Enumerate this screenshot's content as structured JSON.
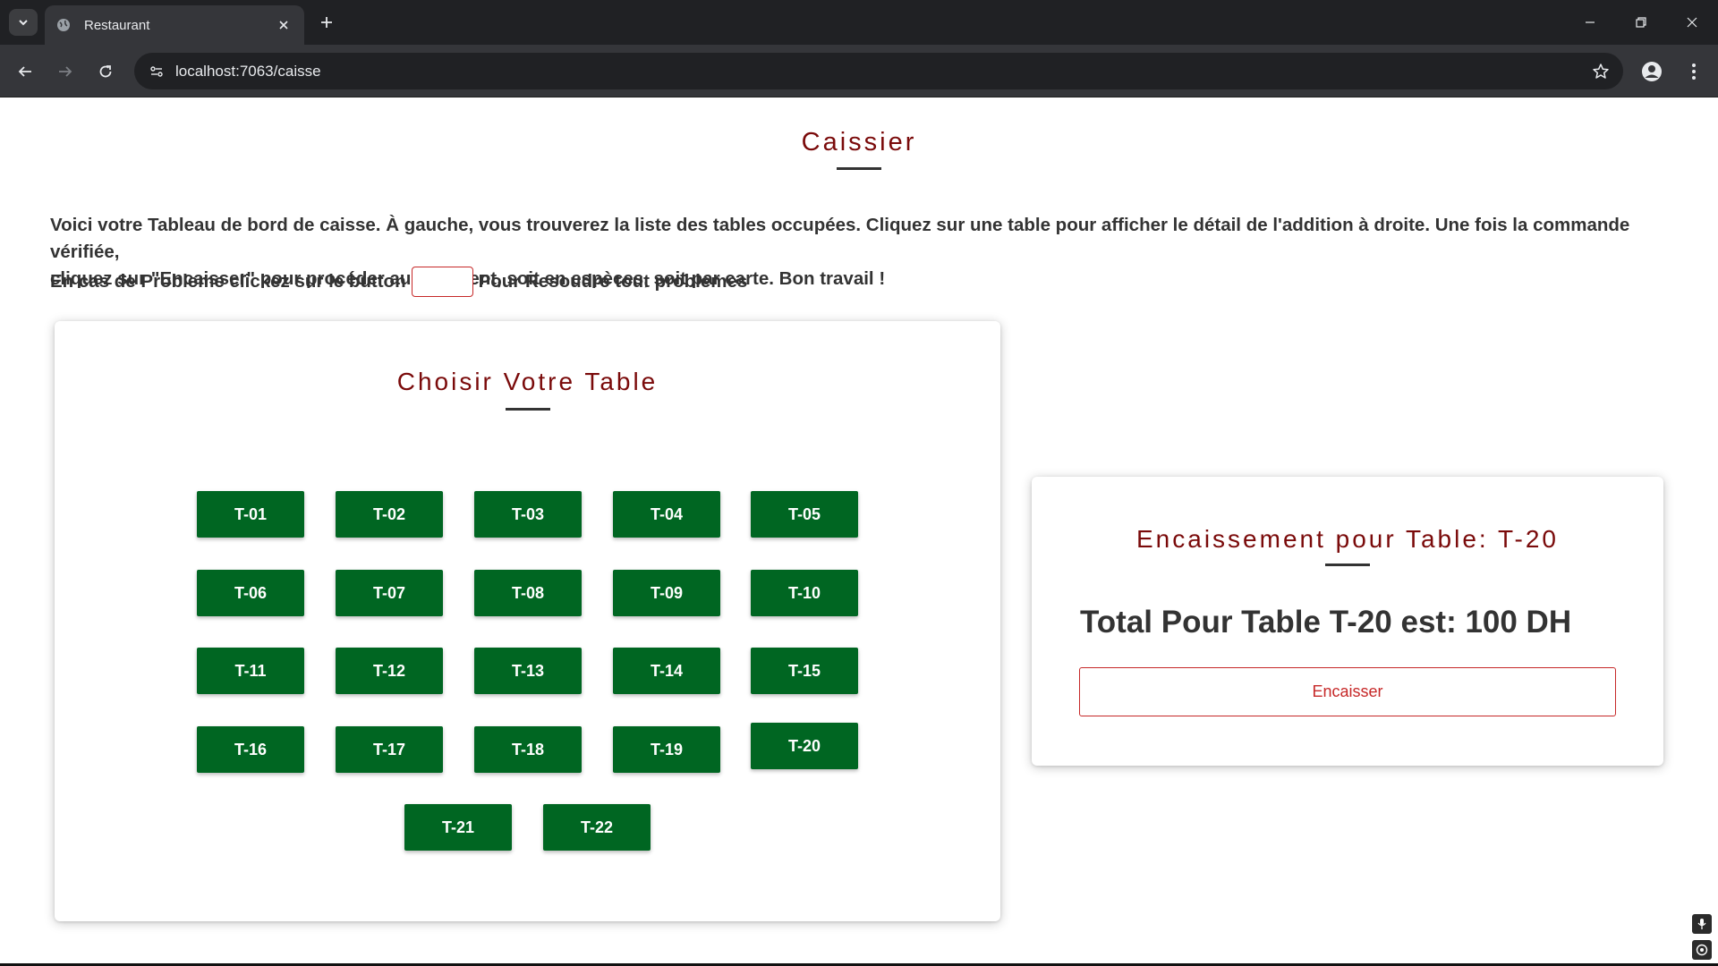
{
  "browser": {
    "tab_title": "Restaurant",
    "url": "localhost:7063/caisse"
  },
  "page": {
    "title": "Caissier",
    "intro_line1": "Voici votre Tableau de bord de caisse. À gauche, vous trouverez la liste des tables occupées. Cliquez sur une table pour afficher le détail de l'addition à droite. Une fois la commande vérifiée,",
    "intro_line2": "cliquez sur \"Encaisser\" pour procéder au paiement, soit en espèces, soit par carte. Bon travail !",
    "help_before": "En cas de Probleme clickez sur le button",
    "help_after": "Pour Resoudre tout problemes"
  },
  "tables_panel": {
    "title": "Choisir Votre Table",
    "tables": [
      "T-01",
      "T-02",
      "T-03",
      "T-04",
      "T-05",
      "T-06",
      "T-07",
      "T-08",
      "T-09",
      "T-10",
      "T-11",
      "T-12",
      "T-13",
      "T-14",
      "T-15",
      "T-16",
      "T-17",
      "T-18",
      "T-19",
      "T-20",
      "T-21",
      "T-22"
    ],
    "selected": "T-20"
  },
  "payment_panel": {
    "title": "Encaissement pour Table: T-20",
    "total_text": "Total Pour Table T-20 est: 100 DH",
    "button_label": "Encaisser"
  },
  "colors": {
    "accent_red": "#7a0a0a",
    "table_green": "#006622",
    "button_border_red": "#c62828"
  }
}
